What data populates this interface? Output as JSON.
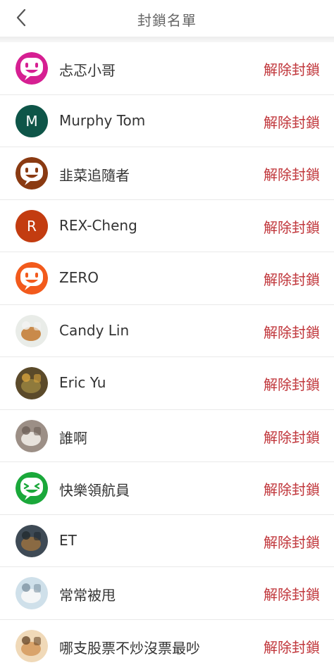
{
  "header": {
    "title": "封鎖名單"
  },
  "colors": {
    "accent": "#c0353a"
  },
  "rows": [
    {
      "name": "忐忑小哥",
      "action": "解除封鎖",
      "avatar": {
        "kind": "smiley",
        "color": "#d61f92",
        "icon": "smiley-icon"
      }
    },
    {
      "name": "Murphy Tom",
      "action": "解除封鎖",
      "avatar": {
        "kind": "letter",
        "letter": "M",
        "color": "#0e5548"
      }
    },
    {
      "name": "韭菜追隨者",
      "action": "解除封鎖",
      "avatar": {
        "kind": "smiley",
        "color": "#8a3a12",
        "icon": "smiley-icon"
      }
    },
    {
      "name": "REX-Cheng",
      "action": "解除封鎖",
      "avatar": {
        "kind": "letter",
        "letter": "R",
        "color": "#c33c10"
      }
    },
    {
      "name": "ZERO",
      "action": "解除封鎖",
      "avatar": {
        "kind": "smiley",
        "color": "#f25a1c",
        "icon": "smiley-icon"
      }
    },
    {
      "name": "Candy Lin",
      "action": "解除封鎖",
      "avatar": {
        "kind": "photo",
        "icon": "dog-photo"
      }
    },
    {
      "name": "Eric Yu",
      "action": "解除封鎖",
      "avatar": {
        "kind": "photo",
        "icon": "food-photo"
      }
    },
    {
      "name": "誰啊",
      "action": "解除封鎖",
      "avatar": {
        "kind": "photo",
        "icon": "cat-photo"
      }
    },
    {
      "name": "快樂領航員",
      "action": "解除封鎖",
      "avatar": {
        "kind": "smiley",
        "color": "#1aa83a",
        "icon": "laughing-icon"
      }
    },
    {
      "name": "ET",
      "action": "解除封鎖",
      "avatar": {
        "kind": "photo",
        "icon": "dark-photo"
      }
    },
    {
      "name": "常常被甩",
      "action": "解除封鎖",
      "avatar": {
        "kind": "photo",
        "icon": "sign-photo"
      }
    },
    {
      "name": "哪支股票不炒沒票最吵",
      "action": "解除封鎖",
      "avatar": {
        "kind": "photo",
        "icon": "cartoon-photo"
      }
    }
  ]
}
